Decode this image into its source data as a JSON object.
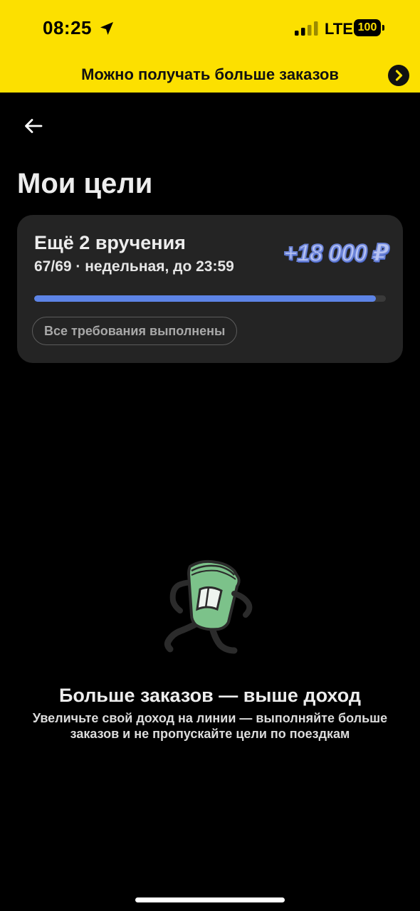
{
  "status_bar": {
    "time": "08:25",
    "network": "LTE",
    "battery": "100"
  },
  "promo_banner": {
    "text": "Можно получать больше заказов"
  },
  "page": {
    "title": "Мои цели"
  },
  "goal": {
    "title": "Ещё 2 вручения",
    "subtitle": "67/69 · недельная, до 23:59",
    "reward": "+18 000 ₽",
    "progress": 0.971,
    "requirements_label": "Все требования выполнены"
  },
  "info": {
    "title": "Больше заказов — выше доход",
    "description": "Увеличьте свой доход на линии — выполняйте больше заказов и не пропускайте цели по поездкам"
  },
  "colors": {
    "accent_yellow": "#fce000",
    "progress_blue": "#5d84e6",
    "card_bg": "#242424",
    "background": "#000000"
  },
  "icons": {
    "location": "location-arrow-icon",
    "signal": "cellular-signal-icon",
    "battery": "battery-icon",
    "promo_arrow": "chevron-right-icon",
    "back": "arrow-left-icon",
    "illustration": "running-money-icon"
  }
}
